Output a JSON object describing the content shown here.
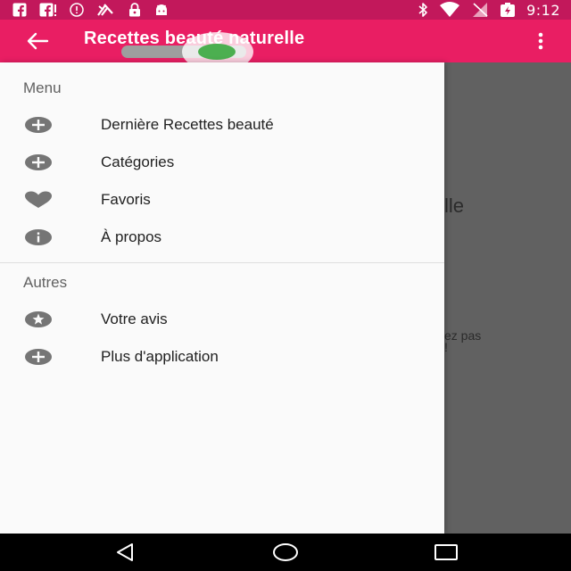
{
  "status_bar": {
    "time": "9:12",
    "left_icons": [
      "facebook-icon",
      "facebook-icon",
      "info-circle-icon",
      "no-signal-icon",
      "lock-icon",
      "android-icon"
    ],
    "right_icons": [
      "bluetooth-icon",
      "wifi-icon",
      "no-sim-icon",
      "battery-charging-icon"
    ]
  },
  "app_bar": {
    "title": "Recettes beauté naturelle",
    "back_icon": "arrow-back-icon",
    "more_icon": "more-vertical-icon"
  },
  "background": {
    "line1": "lle",
    "line2": "ez pas",
    "line3": "!"
  },
  "drawer": {
    "menu_header": "Menu",
    "menu_items": [
      {
        "label": "Dernière Recettes beauté",
        "icon": "plus-circle-icon"
      },
      {
        "label": "Catégories",
        "icon": "plus-circle-icon"
      },
      {
        "label": "Favoris",
        "icon": "heart-icon"
      },
      {
        "label": "À propos",
        "icon": "info-circle-icon"
      }
    ],
    "other_header": "Autres",
    "other_items": [
      {
        "label": "Votre avis",
        "icon": "star-circle-icon"
      },
      {
        "label": "Plus d'application",
        "icon": "plus-circle-icon"
      }
    ]
  },
  "nav_bar": {
    "icons": [
      "back-triangle-icon",
      "home-circle-icon",
      "recents-square-icon"
    ]
  },
  "colors": {
    "primary": "#e91e63",
    "primary_dark": "#c2185b",
    "toggle_on": "#4caf50",
    "icon_gray": "#757575"
  }
}
